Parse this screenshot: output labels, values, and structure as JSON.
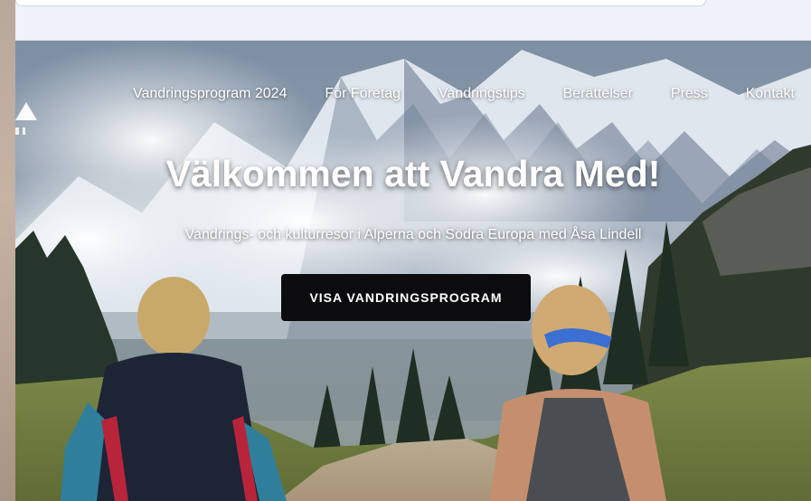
{
  "nav": {
    "items": [
      {
        "label": "Vandringsprogram 2024"
      },
      {
        "label": "För Företag"
      },
      {
        "label": "Vandringstips"
      },
      {
        "label": "Berättelser"
      },
      {
        "label": "Press"
      },
      {
        "label": "Kontakt"
      }
    ]
  },
  "hero": {
    "title": "Välkommen att Vandra Med!",
    "subtitle": "Vandrings- och kulturresor i Alperna och Södra Europa med Åsa Lindell",
    "cta_label": "VISA VANDRINGSPROGRAM"
  },
  "logo": {
    "icon": "mountain-logo-icon",
    "fragment": "DI"
  },
  "colors": {
    "cta_background": "#0c0c0e",
    "nav_text": "#ffffff",
    "chrome_background": "#eef2f9"
  }
}
